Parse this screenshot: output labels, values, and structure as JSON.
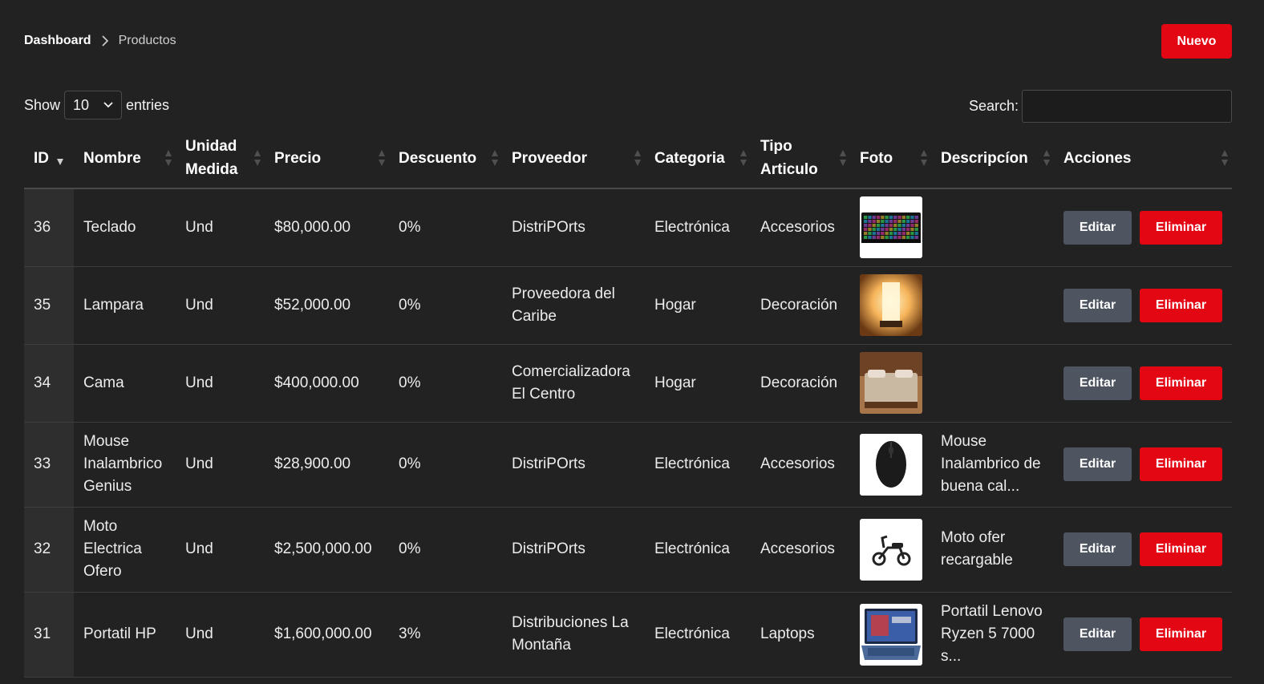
{
  "breadcrumb": {
    "home": "Dashboard",
    "current": "Productos"
  },
  "actions": {
    "new_label": "Nuevo"
  },
  "length": {
    "show_label": "Show",
    "value": "10",
    "entries_label": "entries"
  },
  "search": {
    "label": "Search:",
    "value": ""
  },
  "colors": {
    "accent": "#e30613",
    "edit": "#4e5560",
    "background": "#222222"
  },
  "table": {
    "headers": [
      "ID",
      "Nombre",
      "Unidad Medida",
      "Precio",
      "Descuento",
      "Proveedor",
      "Categoria",
      "Tipo Articulo",
      "Foto",
      "Descripcíon",
      "Acciones"
    ],
    "edit_label": "Editar",
    "delete_label": "Eliminar",
    "rows": [
      {
        "id": "36",
        "nombre": "Teclado",
        "unidad": "Und",
        "precio": "$80,000.00",
        "descuento": "0%",
        "proveedor": "DistriPOrts",
        "categoria": "Electrónica",
        "tipo": "Accesorios",
        "foto": "keyboard-photo",
        "descripcion": ""
      },
      {
        "id": "35",
        "nombre": "Lampara",
        "unidad": "Und",
        "precio": "$52,000.00",
        "descuento": "0%",
        "proveedor": "Proveedora del Caribe",
        "categoria": "Hogar",
        "tipo": "Decoración",
        "foto": "lamp-photo",
        "descripcion": ""
      },
      {
        "id": "34",
        "nombre": "Cama",
        "unidad": "Und",
        "precio": "$400,000.00",
        "descuento": "0%",
        "proveedor": "Comercializadora El Centro",
        "categoria": "Hogar",
        "tipo": "Decoración",
        "foto": "bed-photo",
        "descripcion": ""
      },
      {
        "id": "33",
        "nombre": "Mouse Inalambrico Genius",
        "unidad": "Und",
        "precio": "$28,900.00",
        "descuento": "0%",
        "proveedor": "DistriPOrts",
        "categoria": "Electrónica",
        "tipo": "Accesorios",
        "foto": "mouse-photo",
        "descripcion": "Mouse Inalambrico de buena cal..."
      },
      {
        "id": "32",
        "nombre": "Moto Electrica Ofero",
        "unidad": "Und",
        "precio": "$2,500,000.00",
        "descuento": "0%",
        "proveedor": "DistriPOrts",
        "categoria": "Electrónica",
        "tipo": "Accesorios",
        "foto": "scooter-photo",
        "descripcion": "Moto ofer recargable"
      },
      {
        "id": "31",
        "nombre": "Portatil HP",
        "unidad": "Und",
        "precio": "$1,600,000.00",
        "descuento": "3%",
        "proveedor": "Distribuciones La Montaña",
        "categoria": "Electrónica",
        "tipo": "Laptops",
        "foto": "laptop-photo",
        "descripcion": "Portatil Lenovo Ryzen 5 7000 s..."
      }
    ]
  }
}
